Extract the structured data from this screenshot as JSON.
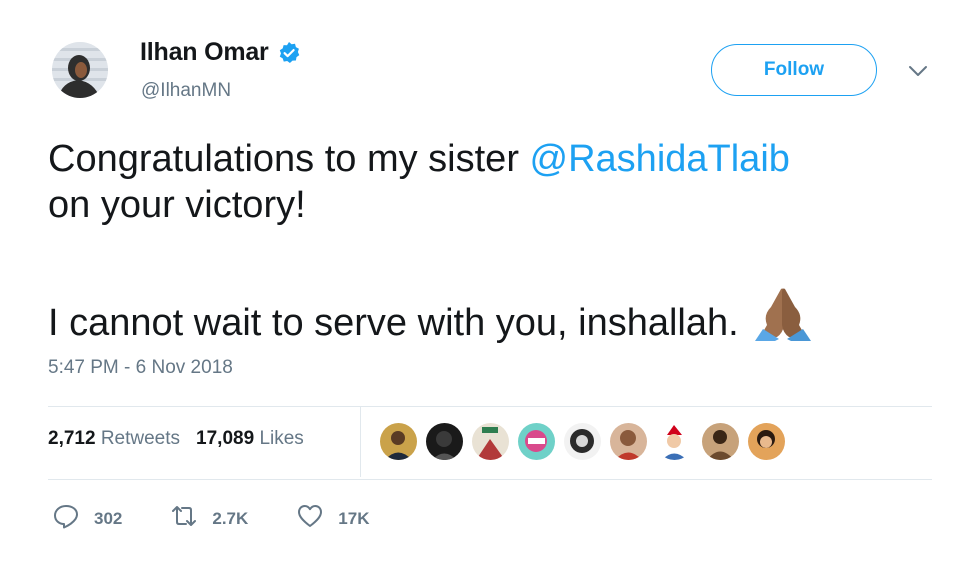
{
  "user": {
    "name": "Ilhan Omar",
    "handle": "@IlhanMN"
  },
  "follow_label": "Follow",
  "tweet": {
    "line1_text": "Congratulations to my sister ",
    "line1_mention": "@RashidaTlaib",
    "line2": "on your victory!",
    "line3": "I cannot wait to serve with you, inshallah."
  },
  "timestamp": "5:47 PM - 6 Nov 2018",
  "stats": {
    "retweets_count": "2,712",
    "retweets_label": "Retweets",
    "likes_count": "17,089",
    "likes_label": "Likes"
  },
  "actions": {
    "replies": "302",
    "retweets": "2.7K",
    "likes": "17K"
  },
  "colors": {
    "accent": "#1da1f2",
    "secondary_text": "#657786",
    "divider": "#e1e8ed"
  },
  "icons": [
    "verified-badge-icon",
    "chevron-down-icon",
    "folded-hands-emoji",
    "reply-icon",
    "retweet-icon",
    "heart-icon"
  ]
}
